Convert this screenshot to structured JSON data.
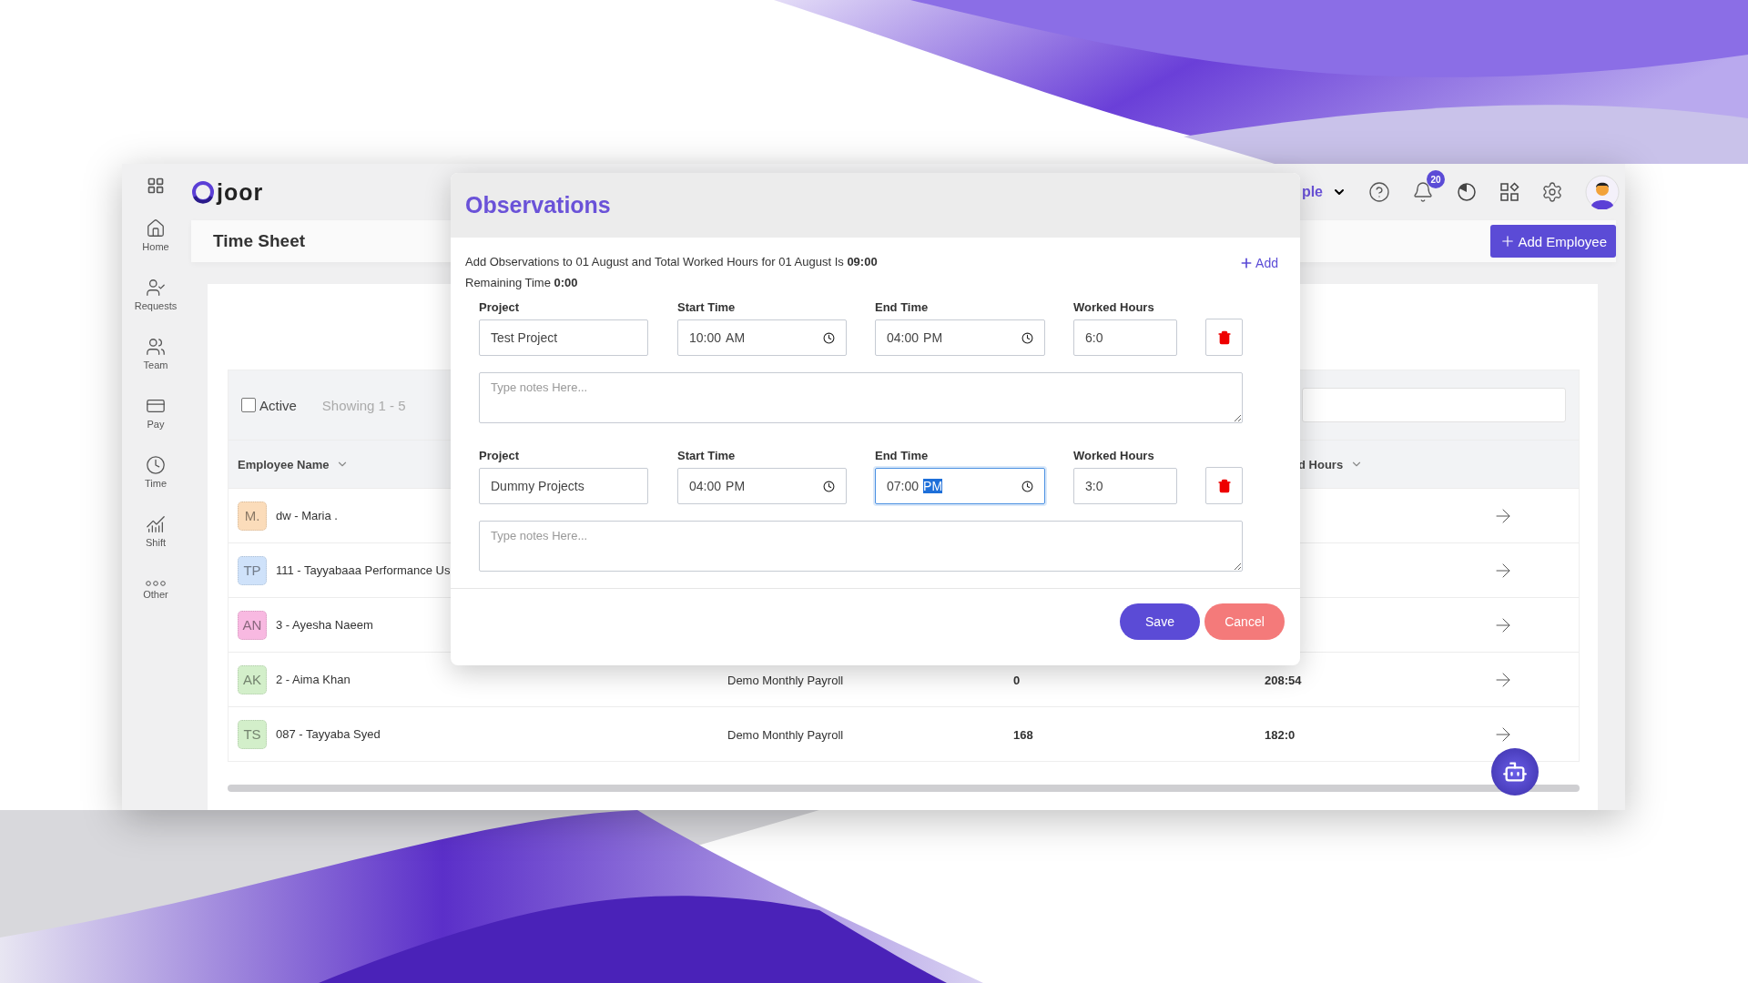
{
  "app": {
    "logo": "joor",
    "menu": "ple",
    "notifications": "20",
    "page_title": "Time Sheet",
    "add_button": "Add Employee"
  },
  "sidebar": {
    "items": [
      {
        "label": "Home"
      },
      {
        "label": "Requests"
      },
      {
        "label": "Team"
      },
      {
        "label": "Pay"
      },
      {
        "label": "Time"
      },
      {
        "label": "Shift"
      },
      {
        "label": "Other"
      }
    ]
  },
  "filter": {
    "active": {
      "label": "Active",
      "checked": false
    },
    "showing": "Showing 1 - 5"
  },
  "table": {
    "columns": {
      "employee_name": "Employee Name",
      "hours": "d  Hours"
    },
    "rows": [
      {
        "initials": "M.",
        "color": "#fbdcba",
        "name": "dw - Maria ."
      },
      {
        "initials": "TP",
        "color": "#cfe2fa",
        "name": "111 - Tayyabaaa Performance Us"
      },
      {
        "initials": "AN",
        "color": "#f8b9e1",
        "name": "3 - Ayesha Naeem"
      },
      {
        "initials": "AK",
        "color": "#d3efca",
        "name": "2 - Aima Khan",
        "payroll": "Demo Monthly Payroll",
        "column_3": "0",
        "hours": "208:54"
      },
      {
        "initials": "TS",
        "color": "#d3efca",
        "name": "087 - Tayyaba Syed",
        "payroll": "Demo Monthly Payroll",
        "column_3": "168",
        "hours": "182:0"
      }
    ]
  },
  "modal": {
    "title": "Observations",
    "summary": "Add Observations to 01 August and Total Worked Hours for 01 August Is **09:00**",
    "remaining": "Remaining Time **0:00**",
    "add": "Add",
    "entries": [
      {
        "labels": {
          "project": "Project",
          "start": "Start Time",
          "end": "End Time",
          "worked": "Worked Hours"
        },
        "project": "Test Project",
        "start": {
          "time": "10:00",
          "period": "AM",
          "focused": false
        },
        "end": {
          "time": "04:00",
          "period": "PM",
          "focused": false
        },
        "worked": "6:0",
        "notes_placeholder": "Type notes Here..."
      },
      {
        "labels": {
          "project": "Project",
          "start": "Start Time",
          "end": "End Time",
          "worked": "Worked Hours"
        },
        "project": "Dummy Projects",
        "start": {
          "time": "04:00",
          "period": "PM",
          "focused": false
        },
        "end": {
          "time": "07:00",
          "period": "PM",
          "focused": true
        },
        "worked": "3:0",
        "notes_placeholder": "Type notes Here..."
      }
    ],
    "save": "Save",
    "cancel": "Cancel"
  }
}
